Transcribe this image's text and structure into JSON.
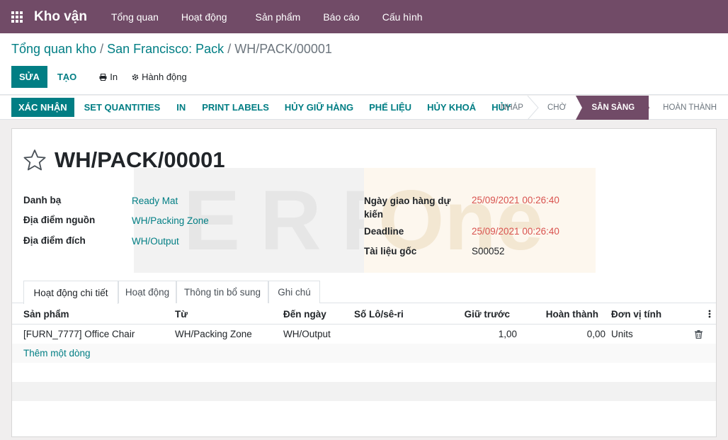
{
  "navbar": {
    "brand": "Kho vận",
    "menu": [
      "Tổng quan",
      "Hoạt động",
      "Sản phẩm",
      "Báo cáo",
      "Cấu hình"
    ]
  },
  "breadcrumb": {
    "part1": "Tổng quan kho",
    "sep1": " / ",
    "part2": "San Francisco: Pack",
    "sep2": " / ",
    "current": "WH/PACK/00001"
  },
  "control_buttons": {
    "edit": "SỬA",
    "create": "TẠO",
    "print": "In",
    "action": "Hành động"
  },
  "status_buttons": [
    "XÁC NHẬN",
    "SET QUANTITIES",
    "IN",
    "PRINT LABELS",
    "HỦY GIỮ HÀNG",
    "PHẾ LIỆU",
    "HỦY KHOÁ",
    "HỦY"
  ],
  "stages": {
    "items": [
      "NHÁP",
      "CHỜ",
      "SẴN SÀNG",
      "HOÀN THÀNH"
    ],
    "active": "SẴN SÀNG"
  },
  "record": {
    "title": "WH/PACK/00001",
    "watermark_left": "ERP",
    "watermark_right": "One",
    "contact_label": "Danh bạ",
    "contact_value": "Ready Mat",
    "source_label": "Địa điểm nguồn",
    "source_value": "WH/Packing Zone",
    "dest_label": "Địa điểm đích",
    "dest_value": "WH/Output",
    "scheduled_label": "Ngày giao hàng dự kiến",
    "scheduled_value": "25/09/2021 00:26:40",
    "deadline_label": "Deadline",
    "deadline_value": "25/09/2021 00:26:40",
    "origin_label": "Tài liệu gốc",
    "origin_value": "S00052"
  },
  "tabs": [
    "Hoạt động chi tiết",
    "Hoạt động",
    "Thông tin bổ sung",
    "Ghi chú"
  ],
  "table": {
    "columns": [
      "Sản phẩm",
      "Từ",
      "Đến ngày",
      "Số Lô/sê-ri",
      "Giữ trước",
      "Hoàn thành",
      "Đơn vị tính"
    ],
    "rows": [
      {
        "product": "[FURN_7777] Office Chair",
        "from": "WH/Packing Zone",
        "to": "WH/Output",
        "lot": "",
        "reserved": "1,00",
        "done": "0,00",
        "uom": "Units"
      }
    ],
    "add_line": "Thêm một dòng"
  },
  "colors": {
    "brand": "#714b67",
    "primary": "#017e84",
    "date": "#d9534f"
  }
}
